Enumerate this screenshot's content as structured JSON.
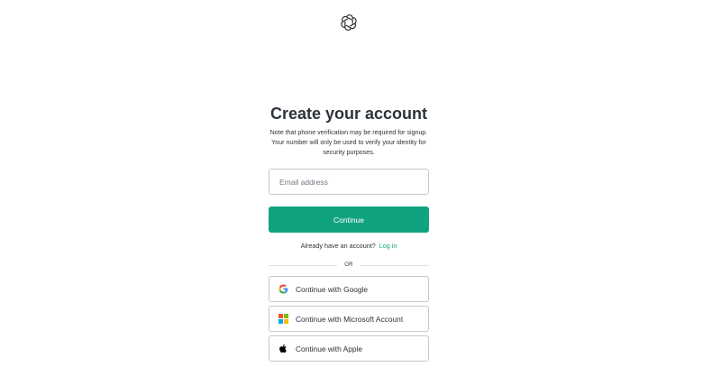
{
  "logo": {
    "icon": "openai-logo-icon"
  },
  "auth": {
    "title": "Create your account",
    "subtitle": "Note that phone verification may be required for signup. Your number will only be used to verify your identity for security purposes.",
    "email_placeholder": "Email address",
    "continue_label": "Continue",
    "login_prompt": "Already have an account?",
    "login_link": "Log in",
    "divider_text": "OR",
    "social": [
      {
        "label": "Continue with Google",
        "icon": "google-icon"
      },
      {
        "label": "Continue with Microsoft Account",
        "icon": "microsoft-icon"
      },
      {
        "label": "Continue with Apple",
        "icon": "apple-icon"
      }
    ]
  },
  "colors": {
    "accent": "#10a37f",
    "text": "#2d333a",
    "border": "#c2c8d0"
  }
}
